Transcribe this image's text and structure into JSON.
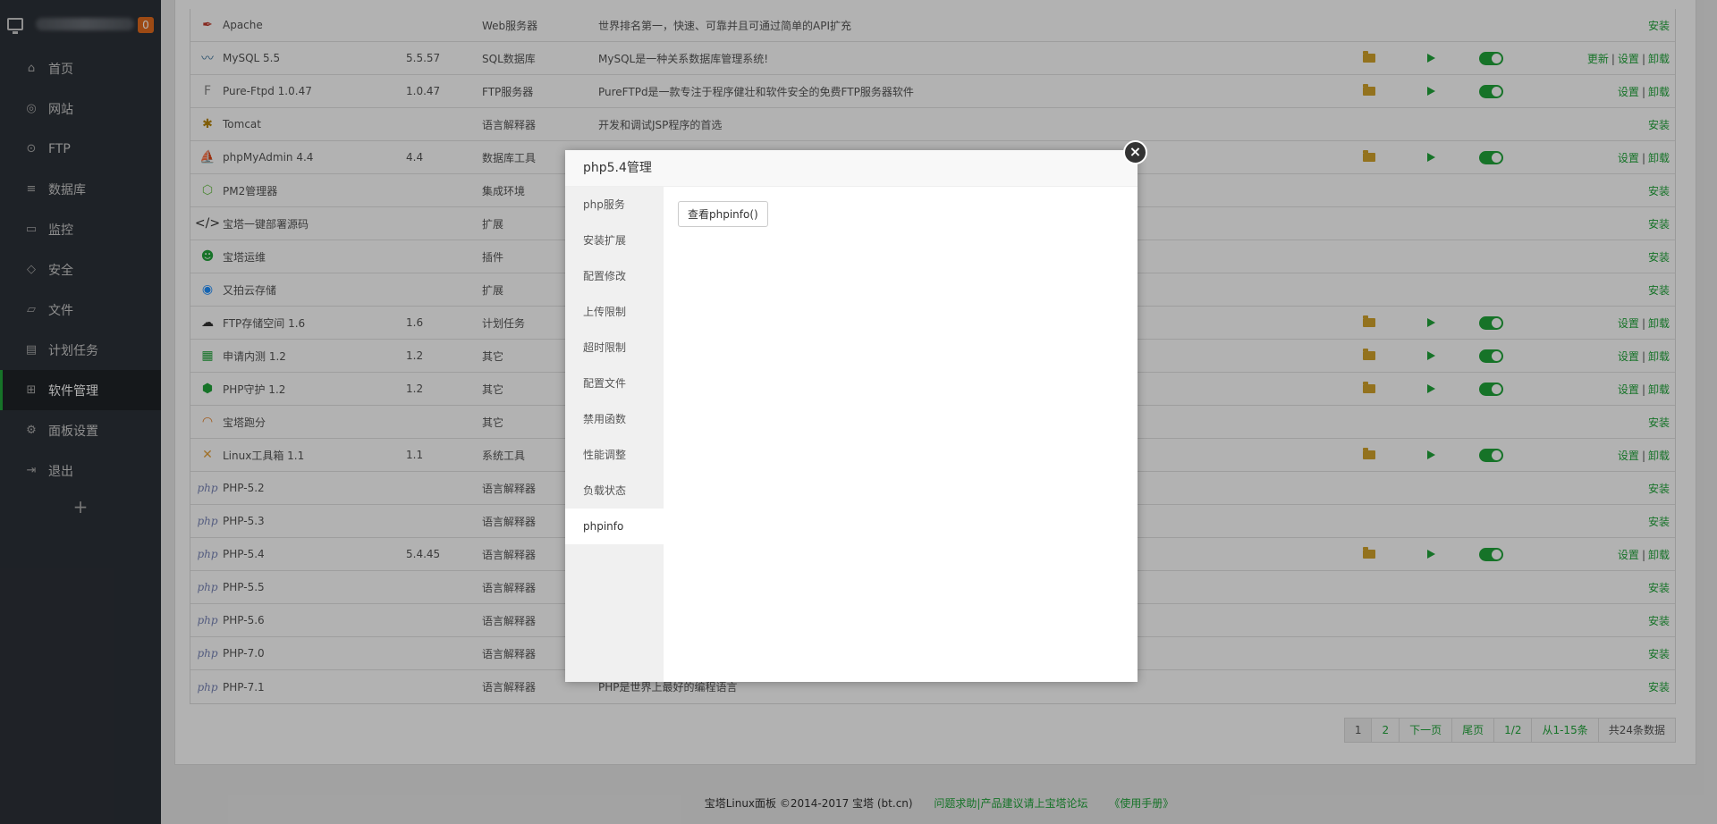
{
  "sidebar": {
    "badge": "0",
    "items": [
      {
        "label": "首页",
        "icon": "home-icon",
        "glyph": "⌂"
      },
      {
        "label": "网站",
        "icon": "globe-icon",
        "glyph": "◎"
      },
      {
        "label": "FTP",
        "icon": "ftp-icon",
        "glyph": "⊙"
      },
      {
        "label": "数据库",
        "icon": "database-icon",
        "glyph": "≡"
      },
      {
        "label": "监控",
        "icon": "monitor-icon",
        "glyph": "▭"
      },
      {
        "label": "安全",
        "icon": "shield-icon",
        "glyph": "◇"
      },
      {
        "label": "文件",
        "icon": "folder-icon",
        "glyph": "▱"
      },
      {
        "label": "计划任务",
        "icon": "calendar-icon",
        "glyph": "▤"
      },
      {
        "label": "软件管理",
        "icon": "grid-icon",
        "glyph": "⊞",
        "active": true
      },
      {
        "label": "面板设置",
        "icon": "gear-icon",
        "glyph": "⚙"
      },
      {
        "label": "退出",
        "icon": "logout-icon",
        "glyph": "⇥"
      }
    ],
    "add": "+"
  },
  "software": [
    {
      "name": "Apache",
      "ver": "",
      "type": "Web服务器",
      "desc": "世界排名第一，快速、可靠并且可通过简单的API扩充",
      "icon": "feather-icon",
      "glyph": "✒",
      "color": "#c0392b",
      "installed": false,
      "actions": [
        "安装"
      ]
    },
    {
      "name": "MySQL 5.5",
      "ver": "5.5.57",
      "type": "SQL数据库",
      "desc": "MySQL是一种关系数据库管理系统!",
      "icon": "dolphin-icon",
      "glyph": "〰",
      "color": "#4479a1",
      "installed": true,
      "actions": [
        "更新",
        "设置",
        "卸载"
      ]
    },
    {
      "name": "Pure-Ftpd 1.0.47",
      "ver": "1.0.47",
      "type": "FTP服务器",
      "desc": "PureFTPd是一款专注于程序健壮和软件安全的免费FTP服务器软件",
      "icon": "ftp-logo-icon",
      "glyph": "F",
      "color": "#888",
      "installed": true,
      "actions": [
        "设置",
        "卸载"
      ]
    },
    {
      "name": "Tomcat",
      "ver": "",
      "type": "语言解释器",
      "desc": "开发和调试JSP程序的首选",
      "icon": "tomcat-icon",
      "glyph": "✱",
      "color": "#b8860b",
      "installed": false,
      "actions": [
        "安装"
      ]
    },
    {
      "name": "phpMyAdmin 4.4",
      "ver": "4.4",
      "type": "数据库工具",
      "desc": "",
      "icon": "sailboat-icon",
      "glyph": "⛵",
      "color": "#e6a23c",
      "installed": true,
      "actions": [
        "设置",
        "卸载"
      ]
    },
    {
      "name": "PM2管理器",
      "ver": "",
      "type": "集成环境",
      "desc": "",
      "icon": "nodejs-icon",
      "glyph": "⬡",
      "color": "#6cc24a",
      "installed": false,
      "actions": [
        "安装"
      ]
    },
    {
      "name": "宝塔一键部署源码",
      "ver": "",
      "type": "扩展",
      "desc": "",
      "icon": "code-icon",
      "glyph": "</>",
      "color": "#333",
      "installed": false,
      "actions": [
        "安装"
      ]
    },
    {
      "name": "宝塔运维",
      "ver": "",
      "type": "插件",
      "desc": "",
      "icon": "operator-icon",
      "glyph": "☻",
      "color": "#20a53a",
      "installed": false,
      "actions": [
        "安装"
      ]
    },
    {
      "name": "又拍云存储",
      "ver": "",
      "type": "扩展",
      "desc": "",
      "icon": "upyun-icon",
      "glyph": "◉",
      "color": "#1e90ff",
      "installed": false,
      "actions": [
        "安装"
      ]
    },
    {
      "name": "FTP存储空间 1.6",
      "ver": "1.6",
      "type": "计划任务",
      "desc": "",
      "icon": "cloud-icon",
      "glyph": "☁",
      "color": "#333",
      "installed": true,
      "actions": [
        "设置",
        "卸载"
      ]
    },
    {
      "name": "申请内测 1.2",
      "ver": "1.2",
      "type": "其它",
      "desc": "",
      "icon": "clipboard-icon",
      "glyph": "▦",
      "color": "#20a53a",
      "installed": true,
      "actions": [
        "设置",
        "卸载"
      ]
    },
    {
      "name": "PHP守护 1.2",
      "ver": "1.2",
      "type": "其它",
      "desc": "",
      "icon": "php-shield-icon",
      "glyph": "⬢",
      "color": "#20a53a",
      "installed": true,
      "actions": [
        "设置",
        "卸载"
      ]
    },
    {
      "name": "宝塔跑分",
      "ver": "",
      "type": "其它",
      "desc": "",
      "icon": "gauge-icon",
      "glyph": "◠",
      "color": "#e67e22",
      "installed": false,
      "actions": [
        "安装"
      ]
    },
    {
      "name": "Linux工具箱 1.1",
      "ver": "1.1",
      "type": "系统工具",
      "desc": "",
      "icon": "tools-icon",
      "glyph": "✕",
      "color": "#e6a23c",
      "installed": true,
      "actions": [
        "设置",
        "卸载"
      ]
    },
    {
      "name": "PHP-5.2",
      "ver": "",
      "type": "语言解释器",
      "desc": "",
      "icon": "php-icon",
      "glyph": "php",
      "color": "#7a86b8",
      "installed": false,
      "actions": [
        "安装"
      ]
    },
    {
      "name": "PHP-5.3",
      "ver": "",
      "type": "语言解释器",
      "desc": "",
      "icon": "php-icon",
      "glyph": "php",
      "color": "#7a86b8",
      "installed": false,
      "actions": [
        "安装"
      ]
    },
    {
      "name": "PHP-5.4",
      "ver": "5.4.45",
      "type": "语言解释器",
      "desc": "",
      "icon": "php-icon",
      "glyph": "php",
      "color": "#7a86b8",
      "installed": true,
      "actions": [
        "设置",
        "卸载"
      ]
    },
    {
      "name": "PHP-5.5",
      "ver": "",
      "type": "语言解释器",
      "desc": "",
      "icon": "php-icon",
      "glyph": "php",
      "color": "#7a86b8",
      "installed": false,
      "actions": [
        "安装"
      ]
    },
    {
      "name": "PHP-5.6",
      "ver": "",
      "type": "语言解释器",
      "desc": "",
      "icon": "php-icon",
      "glyph": "php",
      "color": "#7a86b8",
      "installed": false,
      "actions": [
        "安装"
      ]
    },
    {
      "name": "PHP-7.0",
      "ver": "",
      "type": "语言解释器",
      "desc": "",
      "icon": "php-icon",
      "glyph": "php",
      "color": "#7a86b8",
      "installed": false,
      "actions": [
        "安装"
      ]
    },
    {
      "name": "PHP-7.1",
      "ver": "",
      "type": "语言解释器",
      "desc": "PHP是世界上最好的编程语言",
      "icon": "php-icon",
      "glyph": "php",
      "color": "#7a86b8",
      "installed": false,
      "actions": [
        "安装"
      ]
    }
  ],
  "pager": {
    "p1": "1",
    "p2": "2",
    "next": "下一页",
    "last": "尾页",
    "pages": "1/2",
    "range": "从1-15条",
    "total": "共24条数据"
  },
  "footer": {
    "copyright": "宝塔Linux面板 ©2014-2017 宝塔 (bt.cn)",
    "help": "问题求助|产品建议请上宝塔论坛",
    "manual": "《使用手册》"
  },
  "modal": {
    "title": "php5.4管理",
    "close": "×",
    "menu": [
      "php服务",
      "安装扩展",
      "配置修改",
      "上传限制",
      "超时限制",
      "配置文件",
      "禁用函数",
      "性能调整",
      "负载状态",
      "phpinfo"
    ],
    "active_index": 9,
    "button": "查看phpinfo()"
  },
  "colors": {
    "accent": "#20a53a",
    "sidebar": "#2c3138",
    "badge": "#e16b1d",
    "folder": "#d3a42b"
  }
}
